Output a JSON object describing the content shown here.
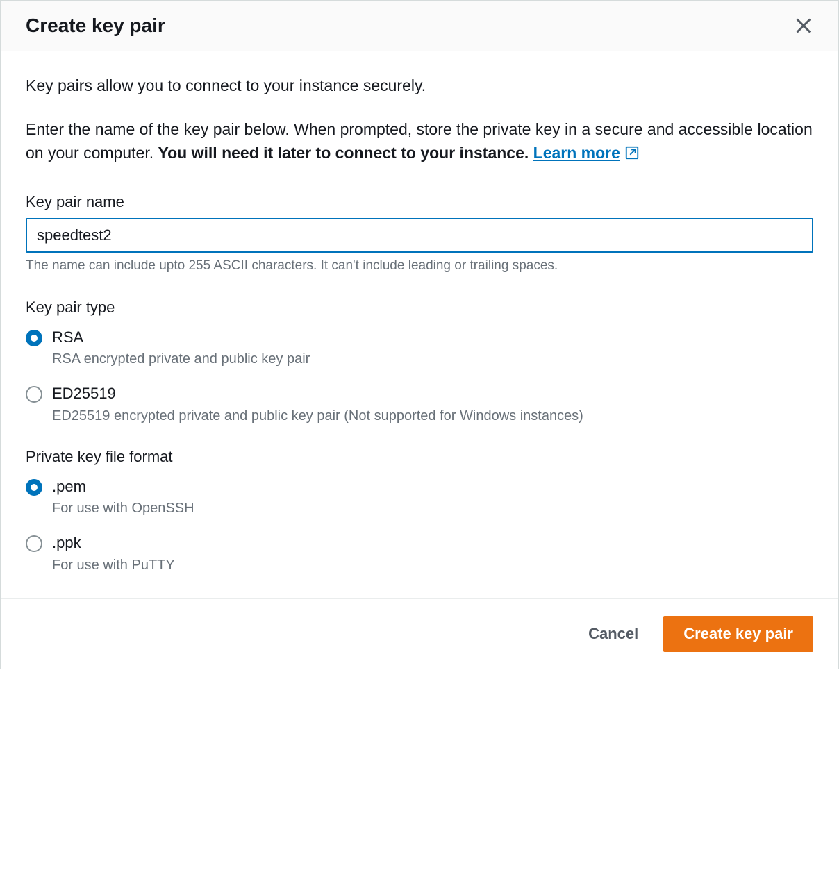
{
  "header": {
    "title": "Create key pair"
  },
  "body": {
    "intro": "Key pairs allow you to connect to your instance securely.",
    "para_prefix": "Enter the name of the key pair below. When prompted, store the private key in a secure and accessible location on your computer. ",
    "para_bold": "You will need it later to connect to your instance. ",
    "learn_more": "Learn more"
  },
  "name_field": {
    "label": "Key pair name",
    "value": "speedtest2",
    "hint": "The name can include upto 255 ASCII characters. It can't include leading or trailing spaces."
  },
  "type_field": {
    "label": "Key pair type",
    "options": [
      {
        "title": "RSA",
        "desc": "RSA encrypted private and public key pair",
        "selected": true
      },
      {
        "title": "ED25519",
        "desc": "ED25519 encrypted private and public key pair (Not supported for Windows instances)",
        "selected": false
      }
    ]
  },
  "format_field": {
    "label": "Private key file format",
    "options": [
      {
        "title": ".pem",
        "desc": "For use with OpenSSH",
        "selected": true
      },
      {
        "title": ".ppk",
        "desc": "For use with PuTTY",
        "selected": false
      }
    ]
  },
  "footer": {
    "cancel": "Cancel",
    "create": "Create key pair"
  }
}
